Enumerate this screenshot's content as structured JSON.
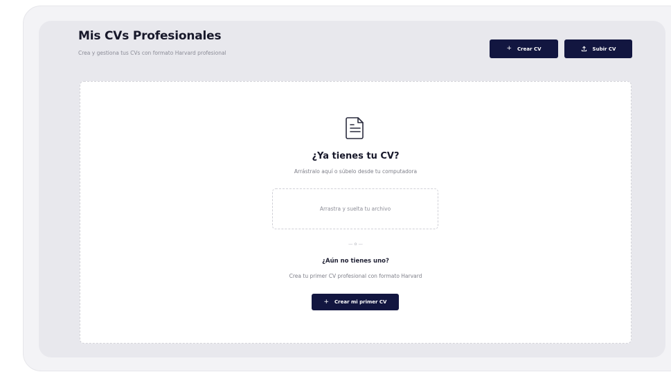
{
  "header": {
    "title": "Mis CVs Profesionales",
    "subtitle": "Crea y gestiona tus CVs con formato Harvard profesional"
  },
  "actions": {
    "create_icon": "+",
    "create_label": "Crear CV",
    "upload_icon": "upload-icon",
    "upload_label": "Subir CV"
  },
  "empty_state": {
    "icon": "document-icon",
    "title": "¿Ya tienes tu CV?",
    "subtitle": "Arrástralo aquí o súbelo desde tu computadora",
    "dropzone_text": "Arrastra y suelta tu archivo",
    "divider": "— o —",
    "alt_title": "¿Aún no tienes uno?",
    "alt_subtitle": "Crea tu primer CV profesional con formato Harvard",
    "alt_button_icon": "+",
    "alt_button_label": "Crear mi primer CV"
  },
  "colors": {
    "primary": "#121640",
    "panel": "#e8e8ed",
    "card": "#ffffff"
  }
}
